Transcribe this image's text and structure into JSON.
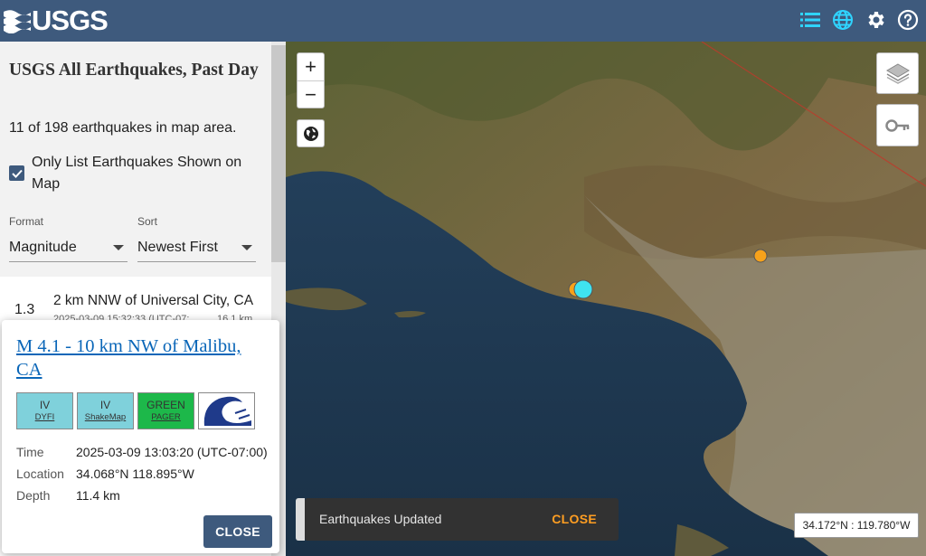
{
  "header": {
    "logo_text": "USGS",
    "icons": [
      "list-icon",
      "globe-icon",
      "gear-icon",
      "help-icon"
    ],
    "color": "#3e5a7d"
  },
  "sidebar": {
    "title": "USGS All Earthquakes, Past Day",
    "count_text": "11 of 198 earthquakes in map area.",
    "checkbox_label": "Only List Earthquakes Shown on Map",
    "checkbox_checked": true,
    "format_caption": "Format",
    "format_value": "Magnitude",
    "sort_caption": "Sort",
    "sort_value": "Newest First",
    "list": [
      {
        "magnitude": "1.3",
        "place": "2 km NNW of Universal City, CA",
        "time": "2025-03-09 15:32:33 (UTC-07:",
        "depth": "16.1 km"
      }
    ]
  },
  "popup": {
    "title": "M 4.1 - 10 km NW of Malibu, CA",
    "badges": [
      {
        "top": "IV",
        "bottom": "DYFI",
        "color": "#7fd1db"
      },
      {
        "top": "IV",
        "bottom": "ShakeMap",
        "color": "#7fd1db"
      },
      {
        "top": "GREEN",
        "bottom": "PAGER",
        "color": "#1db84a"
      }
    ],
    "tsunami_icon": "tsunami-icon",
    "time_label": "Time",
    "time_value": "2025-03-09 13:03:20 (UTC-07:00)",
    "location_label": "Location",
    "location_value": "34.068°N 118.895°W",
    "depth_label": "Depth",
    "depth_value": "11.4 km",
    "close_label": "CLOSE"
  },
  "map": {
    "zoom_in": "+",
    "zoom_out": "−",
    "coords": "34.172°N : 119.780°W",
    "markers": [
      {
        "color": "#f7a21b"
      },
      {
        "color": "#3fe3f0"
      },
      {
        "color": "#f7a21b"
      }
    ]
  },
  "snackbar": {
    "message": "Earthquakes Updated",
    "action": "CLOSE",
    "action_color": "#ff9e22"
  }
}
